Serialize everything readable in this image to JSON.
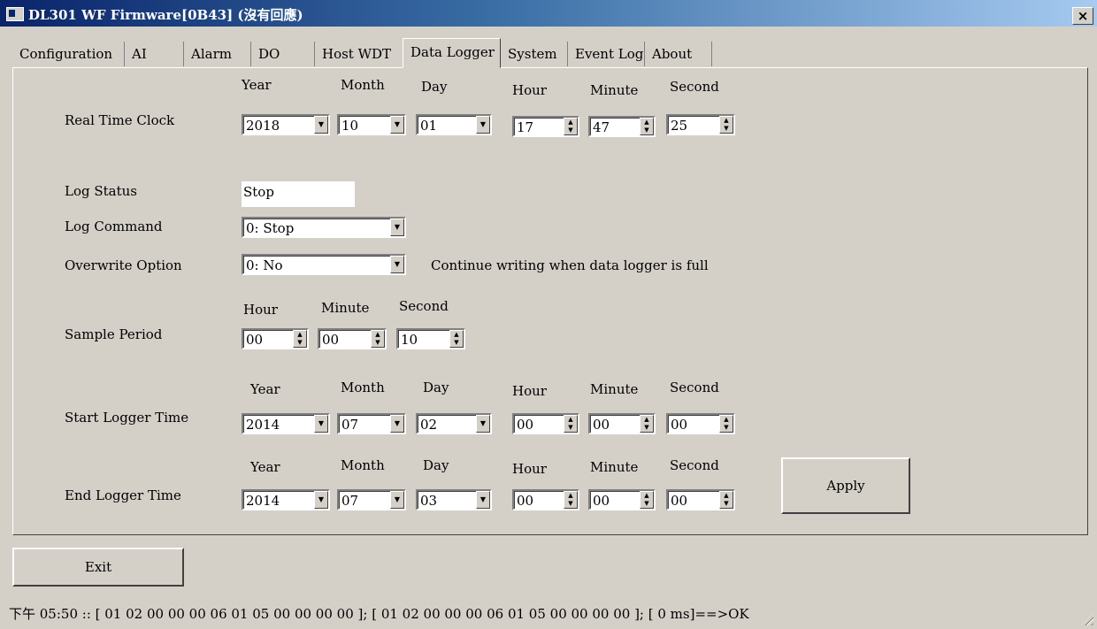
{
  "window": {
    "title": "DL301 WF Firmware[0B43] (沒有回應)",
    "close_glyph": "×"
  },
  "tabs": [
    {
      "label": "Configuration"
    },
    {
      "label": "AI"
    },
    {
      "label": "Alarm"
    },
    {
      "label": "DO"
    },
    {
      "label": "Host WDT"
    },
    {
      "label": "Data Logger"
    },
    {
      "label": "System"
    },
    {
      "label": "Event Log"
    },
    {
      "label": "About"
    }
  ],
  "headers": {
    "year": "Year",
    "month": "Month",
    "day": "Day",
    "hour": "Hour",
    "minute": "Minute",
    "second": "Second"
  },
  "rtc": {
    "label": "Real Time Clock",
    "year": "2018",
    "month": "10",
    "day": "01",
    "hour": "17",
    "minute": "47",
    "second": "25"
  },
  "log_status": {
    "label": "Log Status",
    "value": "Stop"
  },
  "log_command": {
    "label": "Log Command",
    "value": "0: Stop"
  },
  "overwrite": {
    "label": "Overwrite Option",
    "value": "0: No",
    "hint": "Continue writing when data logger is full"
  },
  "sample": {
    "label": "Sample Period",
    "hour": "00",
    "minute": "00",
    "second": "10"
  },
  "start": {
    "label": "Start Logger Time",
    "year": "2014",
    "month": "07",
    "day": "02",
    "hour": "00",
    "minute": "00",
    "second": "00"
  },
  "end": {
    "label": "End Logger Time",
    "year": "2014",
    "month": "07",
    "day": "03",
    "hour": "00",
    "minute": "00",
    "second": "00"
  },
  "apply_label": "Apply",
  "exit_label": "Exit",
  "status_text": "下午 05:50 :: [ 01 02 00 00 00 06 01 05 00 00 00 00  ]; [ 01 02 00 00 00 06 01 05 00 00 00 00  ]; [ 0 ms]==>OK",
  "icons": {
    "combo": "▼",
    "spin_up": "▲",
    "spin_down": "▼"
  }
}
